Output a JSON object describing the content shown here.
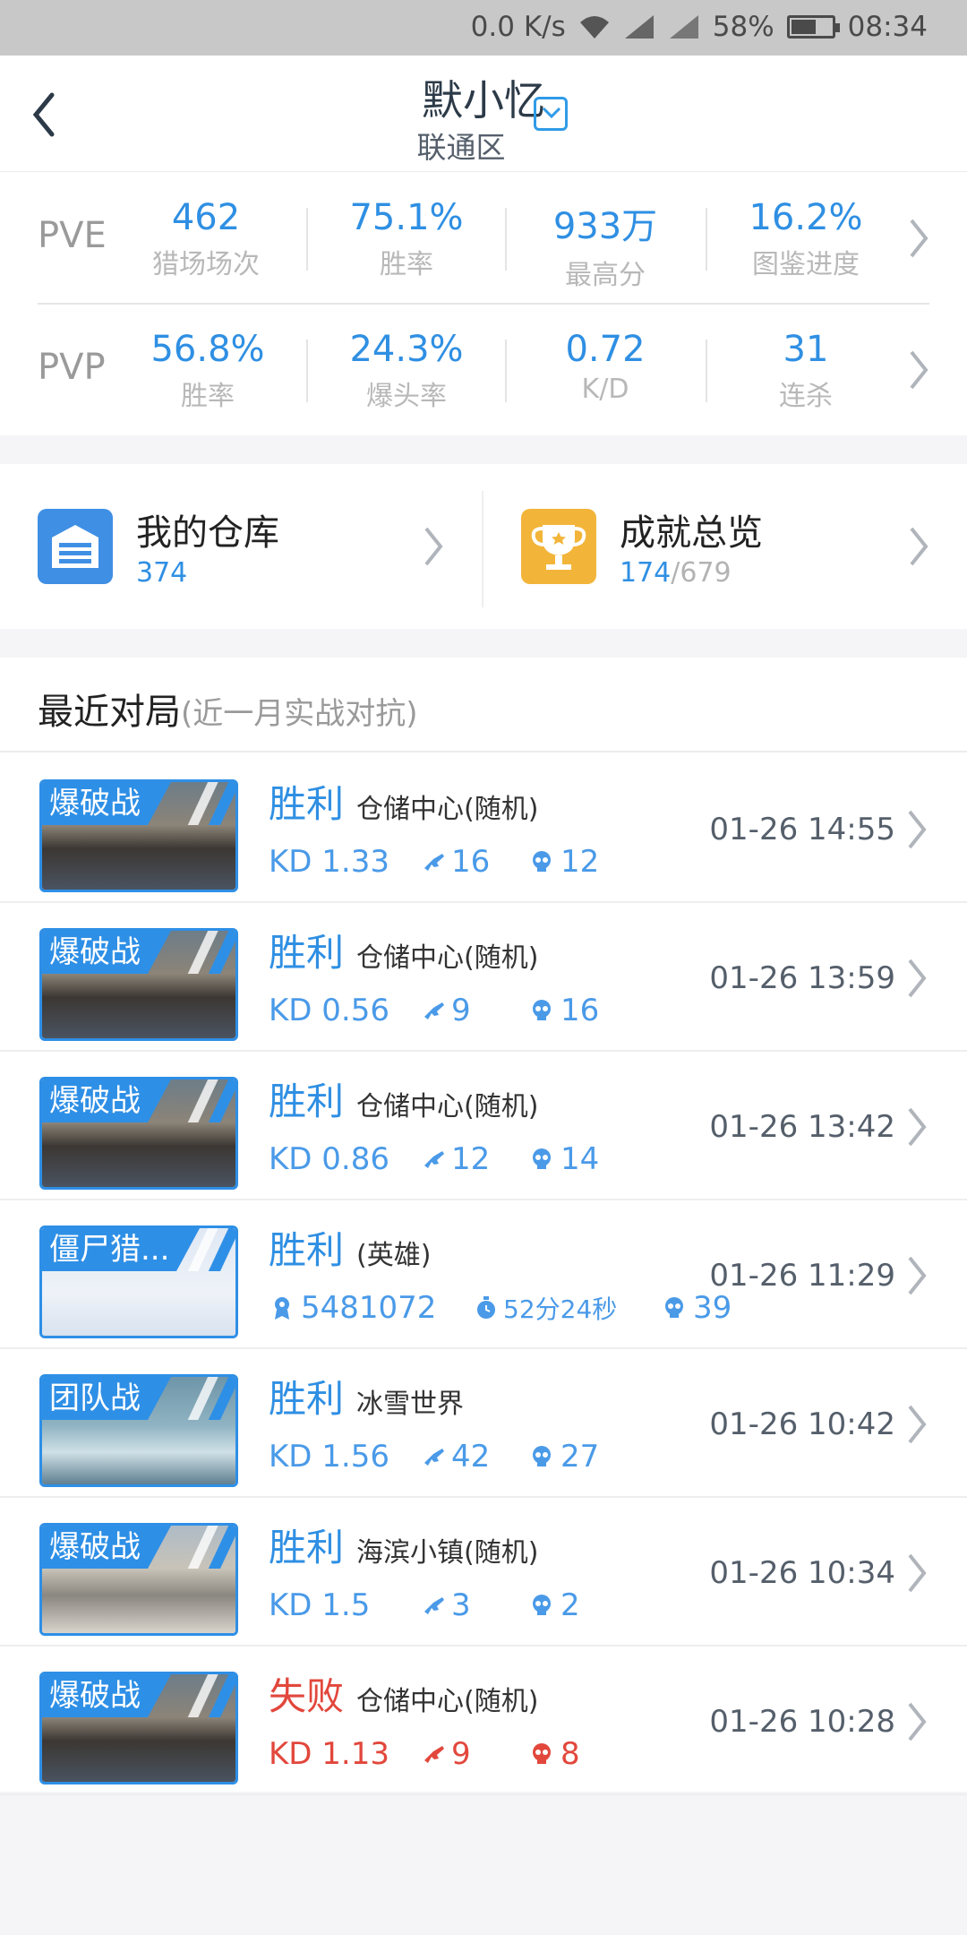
{
  "status_bar": {
    "speed": "0.0 K/s",
    "battery": "58%",
    "time": "08:34"
  },
  "header": {
    "player_name": "默小忆",
    "region": "联通区"
  },
  "pve": {
    "label": "PVE",
    "stats": [
      {
        "value": "462",
        "label": "猎场场次"
      },
      {
        "value": "75.1%",
        "label": "胜率"
      },
      {
        "value": "933万",
        "label": "最高分"
      },
      {
        "value": "16.2%",
        "label": "图鉴进度"
      }
    ]
  },
  "pvp": {
    "label": "PVP",
    "stats": [
      {
        "value": "56.8%",
        "label": "胜率"
      },
      {
        "value": "24.3%",
        "label": "爆头率"
      },
      {
        "value": "0.72",
        "label": "K/D"
      },
      {
        "value": "31",
        "label": "连杀"
      }
    ]
  },
  "links": {
    "warehouse": {
      "label": "我的仓库",
      "count": "374"
    },
    "achievements": {
      "label": "成就总览",
      "count": "174",
      "total": "/679"
    }
  },
  "recent": {
    "title": "最近对局",
    "note": "(近一月实战对抗)",
    "matches": [
      {
        "mode": "爆破战",
        "result": "胜利",
        "map": "仓储中心(随机)",
        "kd": "KD 1.33",
        "s1": "16",
        "s2": "12",
        "time": "01-26 14:55",
        "outcome": "win",
        "scene": "warehouse"
      },
      {
        "mode": "爆破战",
        "result": "胜利",
        "map": "仓储中心(随机)",
        "kd": "KD 0.56",
        "s1": "9",
        "s2": "16",
        "time": "01-26 13:59",
        "outcome": "win",
        "scene": "warehouse"
      },
      {
        "mode": "爆破战",
        "result": "胜利",
        "map": "仓储中心(随机)",
        "kd": "KD 0.86",
        "s1": "12",
        "s2": "14",
        "time": "01-26 13:42",
        "outcome": "win",
        "scene": "warehouse"
      },
      {
        "mode": "僵尸猎...",
        "result": "胜利",
        "map": "(英雄)",
        "kd": "5481072",
        "s1": "52分24秒",
        "s2": "39",
        "time": "01-26 11:29",
        "outcome": "win",
        "scene": "zombie"
      },
      {
        "mode": "团队战",
        "result": "胜利",
        "map": "冰雪世界",
        "kd": "KD 1.56",
        "s1": "42",
        "s2": "27",
        "time": "01-26 10:42",
        "outcome": "win",
        "scene": "ice"
      },
      {
        "mode": "爆破战",
        "result": "胜利",
        "map": "海滨小镇(随机)",
        "kd": "KD 1.5",
        "s1": "3",
        "s2": "2",
        "time": "01-26 10:34",
        "outcome": "win",
        "scene": "seaside"
      },
      {
        "mode": "爆破战",
        "result": "失败",
        "map": "仓储中心(随机)",
        "kd": "KD 1.13",
        "s1": "9",
        "s2": "8",
        "time": "01-26 10:28",
        "outcome": "lose",
        "scene": "warehouse"
      }
    ]
  },
  "colors": {
    "accent": "#2f8fe3",
    "lose": "#e2473c",
    "trophy": "#f2b53a"
  }
}
